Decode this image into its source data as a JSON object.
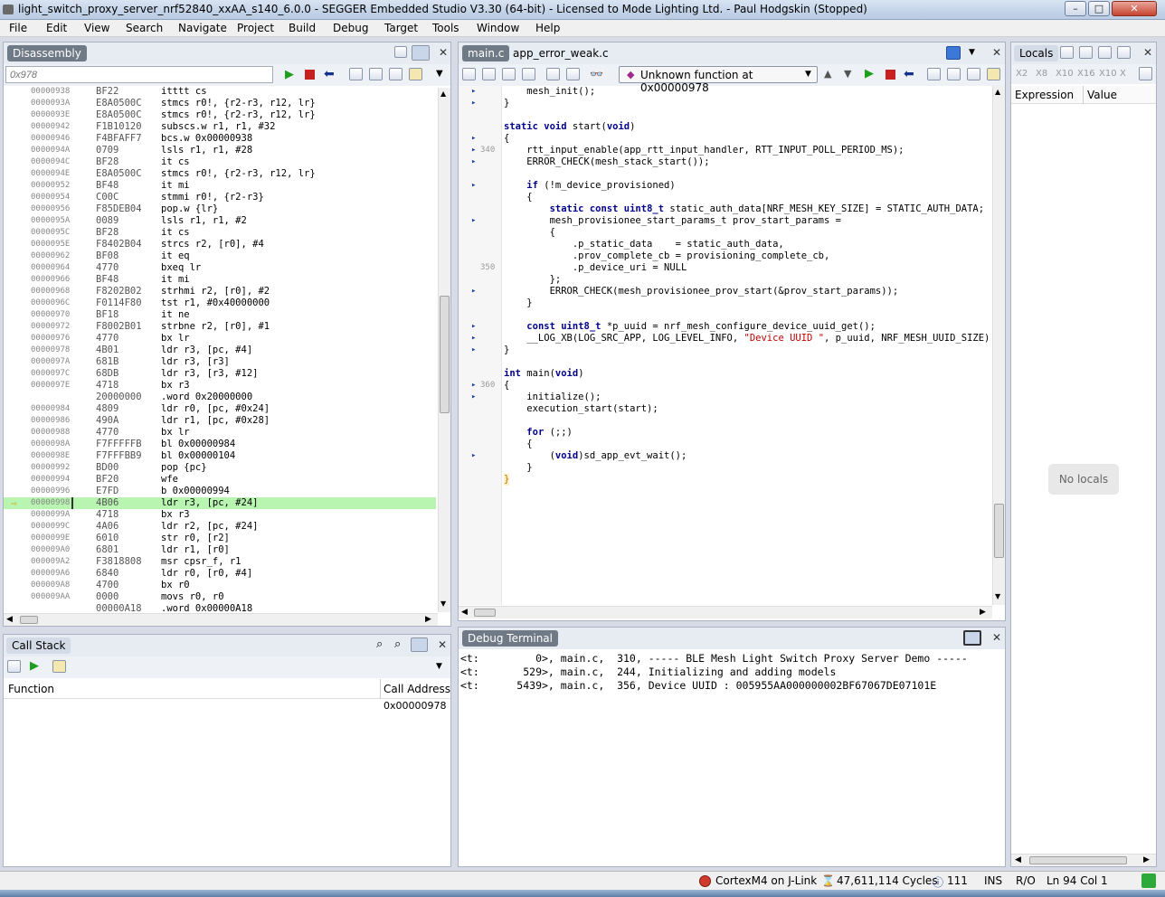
{
  "window": {
    "title": "light_switch_proxy_server_nrf52840_xxAA_s140_6.0.0 - SEGGER Embedded Studio V3.30 (64-bit) - Licensed to Mode Lighting Ltd. - Paul Hodgskin (Stopped)"
  },
  "menu": [
    "File",
    "Edit",
    "View",
    "Search",
    "Navigate",
    "Project",
    "Build",
    "Debug",
    "Target",
    "Tools",
    "Window",
    "Help"
  ],
  "disassembly": {
    "title": "Disassembly",
    "address_input": "0x978",
    "current_index": 35,
    "rows": [
      {
        "a": "00000938",
        "h": "BF22",
        "i": "itttt cs"
      },
      {
        "a": "0000093A",
        "h": "E8A0500C",
        "i": "stmcs r0!, {r2-r3, r12, lr}"
      },
      {
        "a": "0000093E",
        "h": "E8A0500C",
        "i": "stmcs r0!, {r2-r3, r12, lr}"
      },
      {
        "a": "00000942",
        "h": "F1B10120",
        "i": "subscs.w r1, r1, #32"
      },
      {
        "a": "00000946",
        "h": "F4BFAFF7",
        "i": "bcs.w 0x00000938"
      },
      {
        "a": "0000094A",
        "h": "0709",
        "i": "lsls r1, r1, #28"
      },
      {
        "a": "0000094C",
        "h": "BF28",
        "i": "it cs"
      },
      {
        "a": "0000094E",
        "h": "E8A0500C",
        "i": "stmcs r0!, {r2-r3, r12, lr}"
      },
      {
        "a": "00000952",
        "h": "BF48",
        "i": "it mi"
      },
      {
        "a": "00000954",
        "h": "C00C",
        "i": "stmmi r0!, {r2-r3}"
      },
      {
        "a": "00000956",
        "h": "F85DEB04",
        "i": "pop.w {lr}"
      },
      {
        "a": "0000095A",
        "h": "0089",
        "i": "lsls r1, r1, #2"
      },
      {
        "a": "0000095C",
        "h": "BF28",
        "i": "it cs"
      },
      {
        "a": "0000095E",
        "h": "F8402B04",
        "i": "strcs r2, [r0], #4"
      },
      {
        "a": "00000962",
        "h": "BF08",
        "i": "it eq"
      },
      {
        "a": "00000964",
        "h": "4770",
        "i": "bxeq lr"
      },
      {
        "a": "00000966",
        "h": "BF48",
        "i": "it mi"
      },
      {
        "a": "00000968",
        "h": "F8202B02",
        "i": "strhmi r2, [r0], #2"
      },
      {
        "a": "0000096C",
        "h": "F0114F80",
        "i": "tst r1, #0x40000000"
      },
      {
        "a": "00000970",
        "h": "BF18",
        "i": "it ne"
      },
      {
        "a": "00000972",
        "h": "F8002B01",
        "i": "strbne r2, [r0], #1"
      },
      {
        "a": "00000976",
        "h": "4770",
        "i": "bx lr"
      },
      {
        "a": "00000978",
        "h": "4B01",
        "i": "ldr r3, [pc, #4]"
      },
      {
        "a": "0000097A",
        "h": "681B",
        "i": "ldr r3, [r3]"
      },
      {
        "a": "0000097C",
        "h": "68DB",
        "i": "ldr r3, [r3, #12]"
      },
      {
        "a": "0000097E",
        "h": "4718",
        "i": "bx r3"
      },
      {
        "a": "",
        "h": "20000000",
        "i": ".word 0x20000000"
      },
      {
        "a": "00000984",
        "h": "4809",
        "i": "ldr r0, [pc, #0x24]"
      },
      {
        "a": "00000986",
        "h": "490A",
        "i": "ldr r1, [pc, #0x28]"
      },
      {
        "a": "00000988",
        "h": "4770",
        "i": "bx lr"
      },
      {
        "a": "0000098A",
        "h": "F7FFFFFB",
        "i": "bl 0x00000984"
      },
      {
        "a": "0000098E",
        "h": "F7FFFBB9",
        "i": "bl 0x00000104"
      },
      {
        "a": "00000992",
        "h": "BD00",
        "i": "pop {pc}"
      },
      {
        "a": "00000994",
        "h": "BF20",
        "i": "wfe"
      },
      {
        "a": "00000996",
        "h": "E7FD",
        "i": "b 0x00000994"
      },
      {
        "a": "00000998",
        "h": "4B06",
        "i": "ldr r3, [pc, #24]"
      },
      {
        "a": "0000099A",
        "h": "4718",
        "i": "bx r3"
      },
      {
        "a": "0000099C",
        "h": "4A06",
        "i": "ldr r2, [pc, #24]"
      },
      {
        "a": "0000099E",
        "h": "6010",
        "i": "str r0, [r2]"
      },
      {
        "a": "000009A0",
        "h": "6801",
        "i": "ldr r1, [r0]"
      },
      {
        "a": "000009A2",
        "h": "F3818808",
        "i": "msr cpsr_f, r1"
      },
      {
        "a": "000009A6",
        "h": "6840",
        "i": "ldr r0, [r0, #4]"
      },
      {
        "a": "000009A8",
        "h": "4700",
        "i": "bx r0"
      },
      {
        "a": "000009AA",
        "h": "0000",
        "i": "movs r0, r0"
      },
      {
        "a": "",
        "h": "00000A18",
        "i": ".word 0x00000A18"
      }
    ]
  },
  "editor": {
    "tabs": [
      "main.c",
      "app_error_weak.c"
    ],
    "function_dropdown": "Unknown function at 0x00000978",
    "lines": [
      {
        "m": "▸",
        "n": "",
        "t": "    mesh_init();"
      },
      {
        "m": "▸",
        "n": "",
        "t": "}"
      },
      {
        "m": "",
        "n": "",
        "t": ""
      },
      {
        "m": "",
        "n": "",
        "t": "static void start(void)"
      },
      {
        "m": "▸",
        "n": "",
        "t": "{"
      },
      {
        "m": "▸",
        "n": "340",
        "t": "    rtt_input_enable(app_rtt_input_handler, RTT_INPUT_POLL_PERIOD_MS);"
      },
      {
        "m": "▸",
        "n": "",
        "t": "    ERROR_CHECK(mesh_stack_start());"
      },
      {
        "m": "",
        "n": "",
        "t": ""
      },
      {
        "m": "▸",
        "n": "",
        "t": "    if (!m_device_provisioned)"
      },
      {
        "m": "",
        "n": "",
        "t": "    {"
      },
      {
        "m": "",
        "n": "",
        "t": "        static const uint8_t static_auth_data[NRF_MESH_KEY_SIZE] = STATIC_AUTH_DATA;"
      },
      {
        "m": "▸",
        "n": "",
        "t": "        mesh_provisionee_start_params_t prov_start_params ="
      },
      {
        "m": "",
        "n": "",
        "t": "        {"
      },
      {
        "m": "",
        "n": "",
        "t": "            .p_static_data    = static_auth_data,"
      },
      {
        "m": "",
        "n": "",
        "t": "            .prov_complete_cb = provisioning_complete_cb,"
      },
      {
        "m": "",
        "n": "350",
        "t": "            .p_device_uri = NULL"
      },
      {
        "m": "",
        "n": "",
        "t": "        };"
      },
      {
        "m": "▸",
        "n": "",
        "t": "        ERROR_CHECK(mesh_provisionee_prov_start(&prov_start_params));"
      },
      {
        "m": "",
        "n": "",
        "t": "    }"
      },
      {
        "m": "",
        "n": "",
        "t": ""
      },
      {
        "m": "▸",
        "n": "",
        "t": "    const uint8_t *p_uuid = nrf_mesh_configure_device_uuid_get();"
      },
      {
        "m": "▸",
        "n": "",
        "t": "    __LOG_XB(LOG_SRC_APP, LOG_LEVEL_INFO, \"Device UUID \", p_uuid, NRF_MESH_UUID_SIZE);"
      },
      {
        "m": "▸",
        "n": "",
        "t": "}"
      },
      {
        "m": "",
        "n": "",
        "t": ""
      },
      {
        "m": "",
        "n": "",
        "t": "int main(void)"
      },
      {
        "m": "▸",
        "n": "360",
        "t": "{"
      },
      {
        "m": "▸",
        "n": "",
        "t": "    initialize();"
      },
      {
        "m": "",
        "n": "",
        "t": "    execution_start(start);"
      },
      {
        "m": "",
        "n": "",
        "t": ""
      },
      {
        "m": "",
        "n": "",
        "t": "    for (;;)"
      },
      {
        "m": "",
        "n": "",
        "t": "    {"
      },
      {
        "m": "▸",
        "n": "",
        "t": "        (void)sd_app_evt_wait();"
      },
      {
        "m": "",
        "n": "",
        "t": "    }"
      },
      {
        "m": "",
        "n": "",
        "t": "}"
      }
    ]
  },
  "locals": {
    "title": "Locals",
    "col_expression": "Expression",
    "col_value": "Value",
    "empty": "No locals",
    "subscripts": [
      "X2",
      "X8",
      "X10",
      "X16",
      "X10",
      "X"
    ]
  },
  "callstack": {
    "title": "Call Stack",
    "col_function": "Function",
    "col_address": "Call Address",
    "rows": [
      {
        "function": "",
        "address": "0x00000978"
      }
    ]
  },
  "terminal": {
    "title": "Debug Terminal",
    "lines": [
      "<t:         0>, main.c,  310, ----- BLE Mesh Light Switch Proxy Server Demo -----",
      "<t:       529>, main.c,  244, Initializing and adding models",
      "<t:      5439>, main.c,  356, Device UUID : 005955AA000000002BF67067DE07101E"
    ]
  },
  "status": {
    "target": "CortexM4 on J-Link",
    "cycles": "47,611,114 Cycles",
    "count": "111",
    "ins": "INS",
    "ro": "R/O",
    "position": "Ln 94 Col 1"
  },
  "colors": {
    "current_line": "#b8f5b0",
    "keyword": "#00008b",
    "string": "#c00000",
    "tab_active": "#6f7a86"
  }
}
